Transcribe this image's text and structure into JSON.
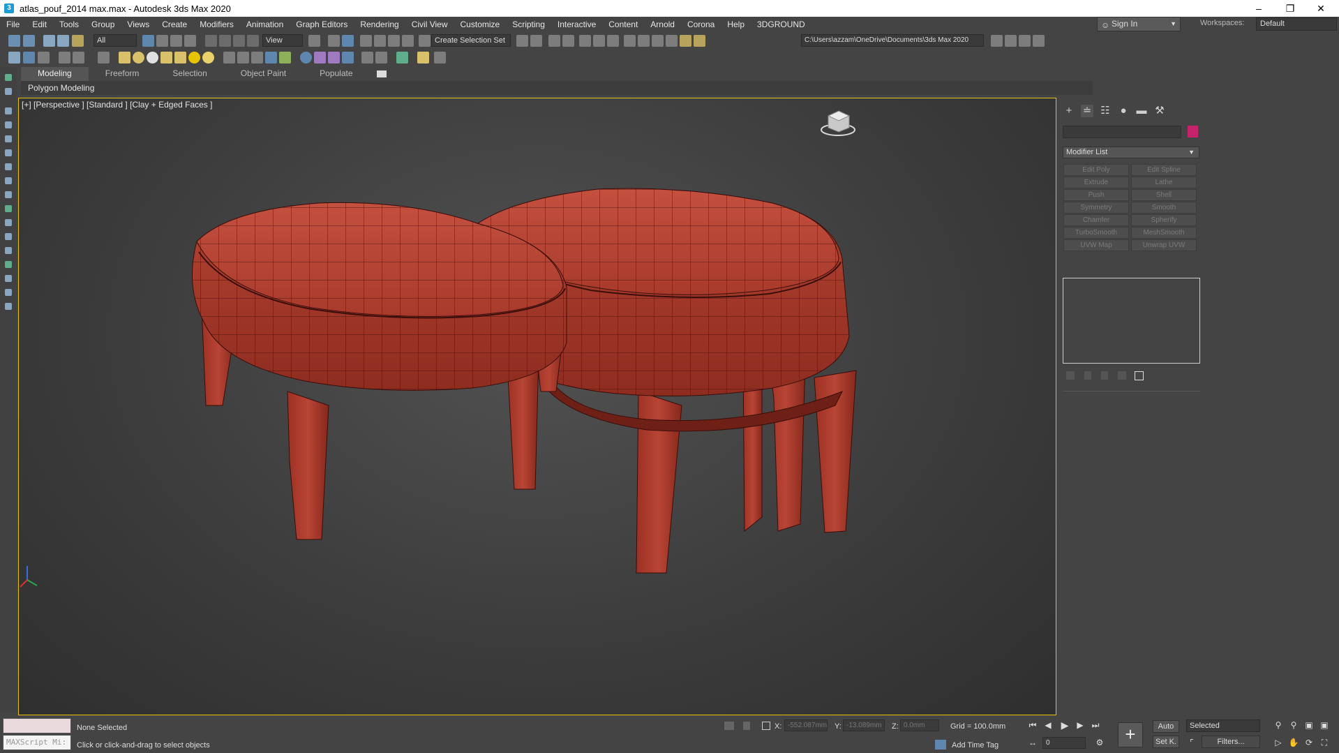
{
  "window": {
    "title": "atlas_pouf_2014 max.max - Autodesk 3ds Max 2020"
  },
  "menu": [
    "File",
    "Edit",
    "Tools",
    "Group",
    "Views",
    "Create",
    "Modifiers",
    "Animation",
    "Graph Editors",
    "Rendering",
    "Civil View",
    "Customize",
    "Scripting",
    "Interactive",
    "Content",
    "Arnold",
    "Corona",
    "Help",
    "3DGROUND"
  ],
  "account": {
    "sign_in": "Sign In",
    "workspaces_label": "Workspaces:",
    "workspace": "Default"
  },
  "toolbar": {
    "filter": "All",
    "ref_coord": "View",
    "selection_set": "Create Selection Set",
    "project_path": "C:\\Users\\azzam\\OneDrive\\Documents\\3ds Max 2020"
  },
  "ribbon": {
    "tabs": [
      "Modeling",
      "Freeform",
      "Selection",
      "Object Paint",
      "Populate"
    ],
    "panel": "Polygon Modeling"
  },
  "viewport": {
    "label": "[+] [Perspective ] [Standard ] [Clay + Edged Faces ]"
  },
  "command_panel": {
    "modifier_list": "Modifier List",
    "modifiers": [
      [
        "Edit Poly",
        "Edit Spline"
      ],
      [
        "Extrude",
        "Lathe"
      ],
      [
        "Push",
        "Shell"
      ],
      [
        "Symmetry",
        "Smooth"
      ],
      [
        "Chamfer",
        "Spherify"
      ],
      [
        "TurboSmooth",
        "MeshSmooth"
      ],
      [
        "UVW Map",
        "Unwrap UVW"
      ]
    ],
    "object_color": "#c5246a"
  },
  "status": {
    "maxscript": "MAXScript Mi:",
    "selection": "None Selected",
    "prompt": "Click or click-and-drag to select objects",
    "x": "-552.087mm",
    "y": "-13.089mm",
    "z": "0.0mm",
    "x_label": "X:",
    "y_label": "Y:",
    "z_label": "Z:",
    "grid": "Grid = 100.0mm",
    "add_time_tag": "Add Time Tag",
    "auto": "Auto",
    "selected": "Selected",
    "set_key": "Set K.",
    "filters": "Filters...",
    "frame": "0"
  }
}
